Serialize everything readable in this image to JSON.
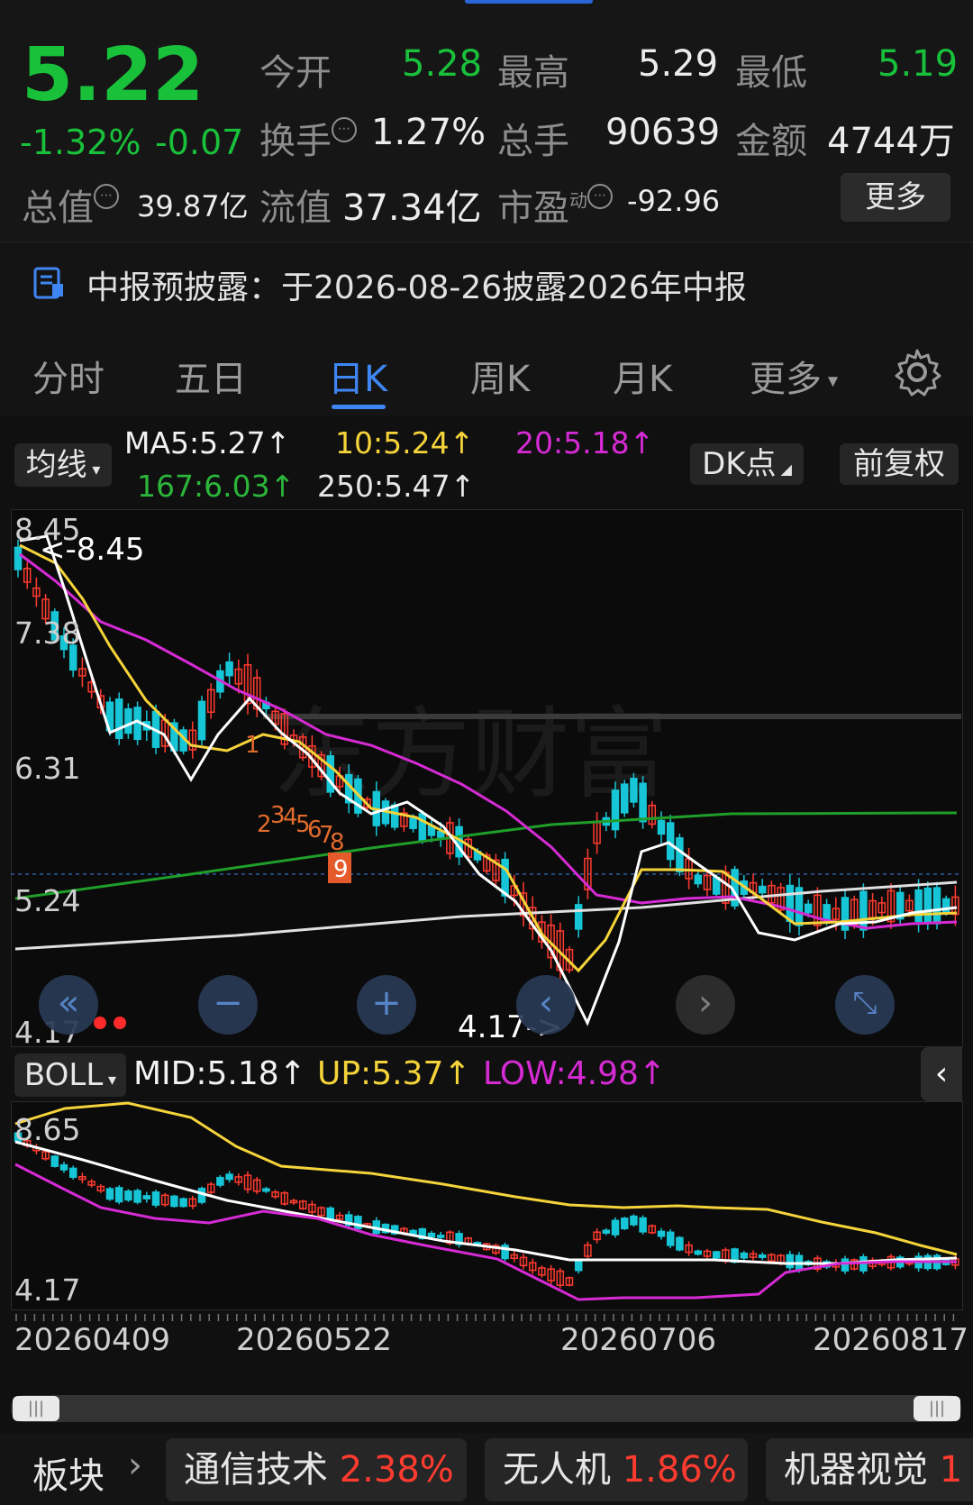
{
  "colors": {
    "up": "#ff3b30",
    "down": "#19c13b",
    "accent": "#3f86f5",
    "ma5": "#ffffff",
    "ma10": "#f5d33a",
    "ma20": "#d62bd4",
    "ma167": "#1f9e2a",
    "ma250": "#e8e8e8"
  },
  "quote": {
    "price": "5.22",
    "change_pct": "-1.32%",
    "change": "-0.07",
    "open_label": "今开",
    "open": "5.28",
    "high_label": "最高",
    "high": "5.29",
    "low_label": "最低",
    "low": "5.19",
    "turnover_label": "换手",
    "turnover": "1.27%",
    "volume_label": "总手",
    "volume": "90639",
    "amount_label": "金额",
    "amount": "4744万",
    "mktcap_label": "总值",
    "mktcap": "39.87亿",
    "float_label": "流值",
    "float": "37.34亿",
    "pe_label": "市盈",
    "pe_sup": "动",
    "pe": "-92.96",
    "more": "更多"
  },
  "notice": {
    "icon": "report-icon",
    "text": "中报预披露：于2026-08-26披露2026年中报"
  },
  "tabs": [
    "分时",
    "五日",
    "日K",
    "周K",
    "月K",
    "更多"
  ],
  "active_tab": "日K",
  "indicators": {
    "ma_select": "均线",
    "ma5": "MA5:5.27↑",
    "ma10": "10:5.24↑",
    "ma20": "20:5.18↑",
    "ma167": "167:6.03↑",
    "ma250": "250:5.47↑",
    "dk": "DK点",
    "adjust": "前复权"
  },
  "kchart": {
    "y_labels": [
      "8.45",
      "7.38",
      "6.31",
      "5.24",
      "4.17"
    ],
    "max_label": "<-8.45",
    "min_label": "4.17->",
    "signals": [
      "1",
      "2",
      "3",
      "4",
      "5",
      "6",
      "7",
      "8",
      "9"
    ],
    "watermark": "东方财富"
  },
  "boll": {
    "select": "BOLL",
    "mid": "MID:5.18↑",
    "up": "UP:5.37↑",
    "low": "LOW:4.98↑",
    "y_top": "8.65",
    "y_bottom": "4.17"
  },
  "dates": [
    "20260409",
    "20260522",
    "20260706",
    "20260817"
  ],
  "sectors": {
    "label": "板块",
    "items": [
      {
        "name": "通信技术",
        "pct": "2.38%"
      },
      {
        "name": "无人机",
        "pct": "1.86%"
      },
      {
        "name": "机器视觉",
        "pct": "1"
      }
    ]
  },
  "chart_data": {
    "type": "candlestick",
    "series": [
      {
        "name": "MA5",
        "values": []
      },
      {
        "name": "BOLL MID",
        "values": []
      }
    ],
    "ylim": [
      4.17,
      8.45
    ],
    "x_ticks": [
      "20260409",
      "20260522",
      "20260706",
      "20260817"
    ],
    "annotations": [
      "<-8.45",
      "4.17->"
    ]
  }
}
